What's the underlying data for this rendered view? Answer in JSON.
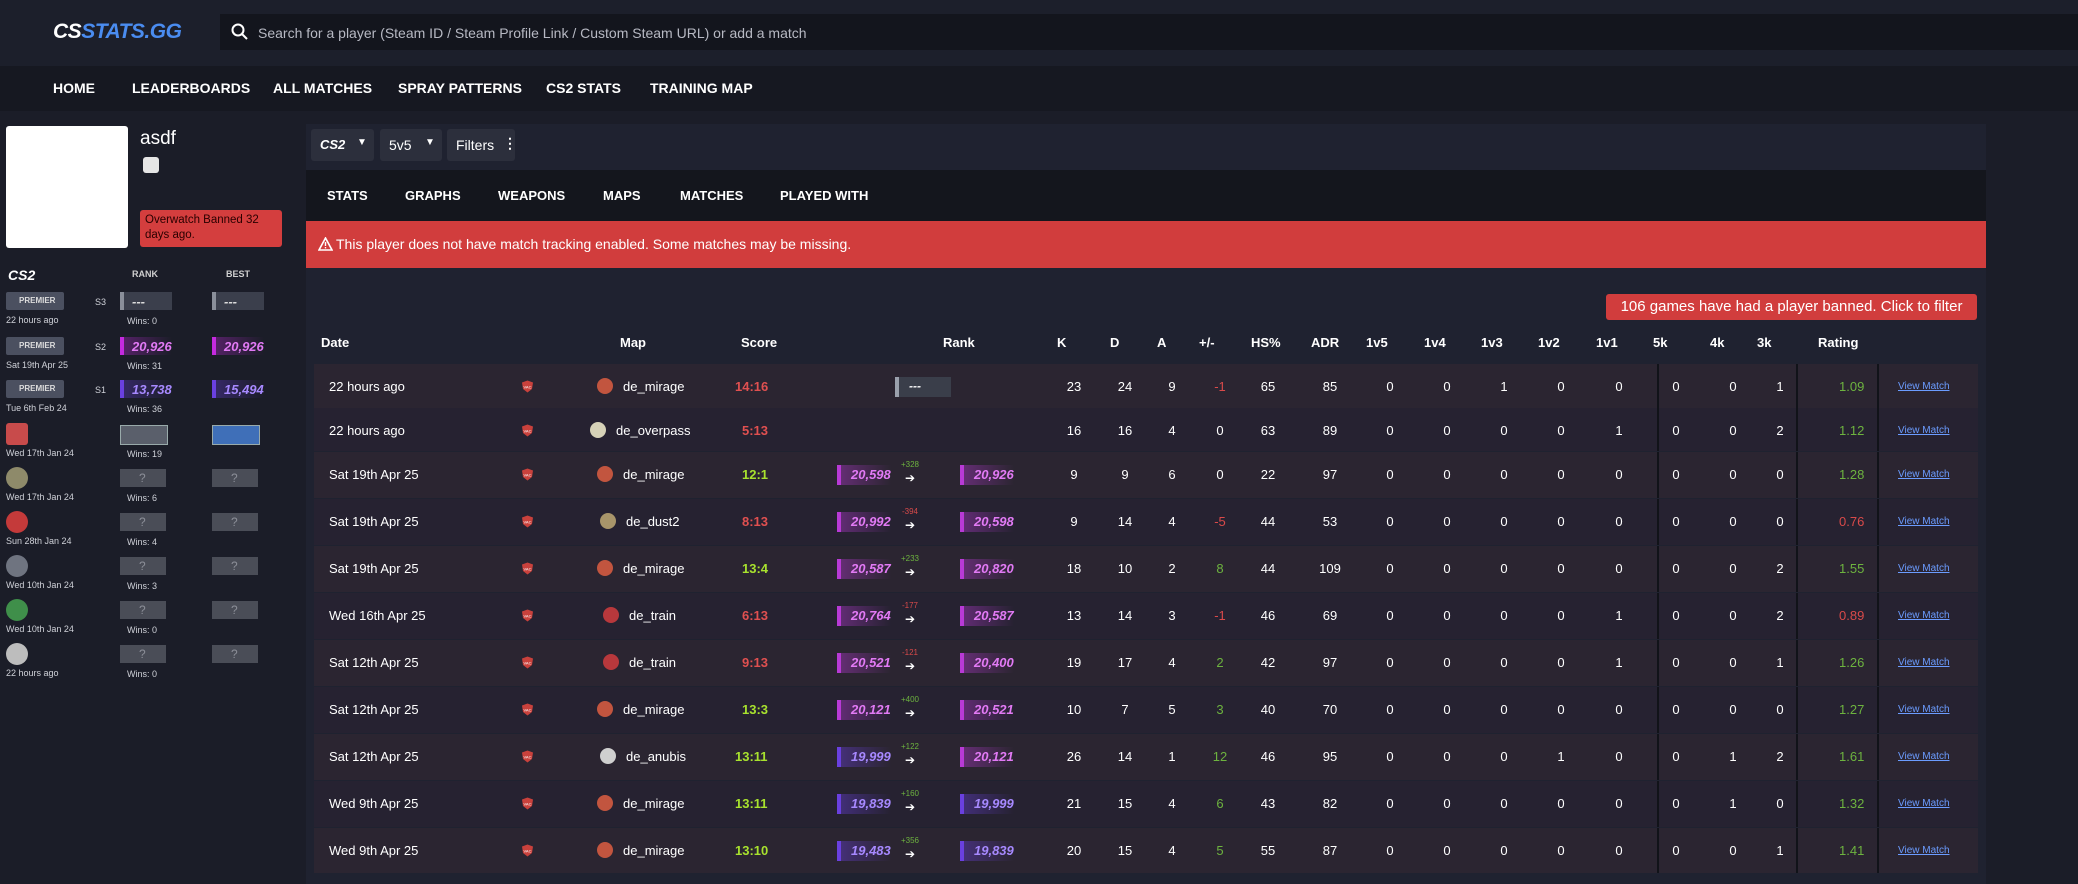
{
  "header": {
    "logo_a": "CS",
    "logo_b": "STATS.GG",
    "search_placeholder": "Search for a player (Steam ID / Steam Profile Link / Custom Steam URL) or add a match"
  },
  "nav": [
    "HOME",
    "LEADERBOARDS",
    "ALL MATCHES",
    "SPRAY PATTERNS",
    "CS2 STATS",
    "TRAINING MAP"
  ],
  "profile": {
    "name": "asdf",
    "ban_text": "Overwatch Banned 32 days ago."
  },
  "sidebar": {
    "logo": "CS2",
    "rank_header": "RANK",
    "best_header": "BEST",
    "rows": [
      {
        "date": "22 hours ago",
        "season": "S3",
        "rank": "---",
        "best": "---",
        "wins": "Wins: 0",
        "type": "premier",
        "color": "#8a8f9a"
      },
      {
        "date": "Sat 19th Apr 25",
        "season": "S2",
        "rank": "20,926",
        "best": "20,926",
        "wins": "Wins: 31",
        "type": "premier",
        "color": "#c42adf"
      },
      {
        "date": "Tue 6th Feb 24",
        "season": "S1",
        "rank": "13,738",
        "best": "15,494",
        "wins": "Wins: 36",
        "type": "premier",
        "color": "#6a40e0"
      },
      {
        "date": "Wed 17th Jan 24",
        "season": "",
        "rank": "",
        "best": "",
        "wins": "Wins: 19",
        "type": "competitive",
        "color": "#c84b4b"
      },
      {
        "date": "Wed 17th Jan 24",
        "season": "",
        "rank": "?",
        "best": "?",
        "wins": "Wins: 6",
        "type": "map",
        "color": "#8e8a6a"
      },
      {
        "date": "Sun 28th Jan 24",
        "season": "",
        "rank": "?",
        "best": "?",
        "wins": "Wins: 4",
        "type": "map",
        "color": "#c43a3a"
      },
      {
        "date": "Wed 10th Jan 24",
        "season": "",
        "rank": "?",
        "best": "?",
        "wins": "Wins: 3",
        "type": "map",
        "color": "#6f7480"
      },
      {
        "date": "Wed 10th Jan 24",
        "season": "",
        "rank": "?",
        "best": "?",
        "wins": "Wins: 0",
        "type": "map",
        "color": "#3f8f4a"
      },
      {
        "date": "22 hours ago",
        "season": "",
        "rank": "?",
        "best": "?",
        "wins": "Wins: 0",
        "type": "map",
        "color": "#bdbdbd"
      }
    ]
  },
  "controls": {
    "game": "CS2",
    "mode": "5v5",
    "filters": "Filters"
  },
  "tabs": [
    "STATS",
    "GRAPHS",
    "WEAPONS",
    "MAPS",
    "MATCHES",
    "PLAYED WITH"
  ],
  "alert": "This player does not have match tracking enabled. Some matches may be missing.",
  "banned_filter": "106 games have had a player banned. Click to filter",
  "columns": [
    "Date",
    "Map",
    "Score",
    "Rank",
    "K",
    "D",
    "A",
    "+/-",
    "HS%",
    "ADR",
    "1v5",
    "1v4",
    "1v3",
    "1v2",
    "1v1",
    "5k",
    "4k",
    "3k",
    "Rating"
  ],
  "view_label": "View Match",
  "colors": {
    "win": "#a8e22e",
    "loss": "#e05050",
    "tie": "#e05050",
    "pos": "#6db33f",
    "neg": "#d94a4a"
  },
  "matches": [
    {
      "date": "22 hours ago",
      "map": "de_mirage",
      "score": "14:16",
      "result": "loss",
      "rank_before": "",
      "delta": "",
      "rank_after": "",
      "unranked": true,
      "k": "23",
      "d": "24",
      "a": "9",
      "pm": "-1",
      "hs": "65",
      "adr": "85",
      "v5": "0",
      "v4": "0",
      "v3": "1",
      "v2": "0",
      "v1": "0",
      "k5": "0",
      "k4": "0",
      "k3": "1",
      "rating": "1.09",
      "rating_sign": "pos"
    },
    {
      "date": "22 hours ago",
      "map": "de_overpass",
      "score": "5:13",
      "result": "loss",
      "rank_before": "",
      "delta": "",
      "rank_after": "",
      "unranked": false,
      "k": "16",
      "d": "16",
      "a": "4",
      "pm": "0",
      "hs": "63",
      "adr": "89",
      "v5": "0",
      "v4": "0",
      "v3": "0",
      "v2": "0",
      "v1": "1",
      "k5": "0",
      "k4": "0",
      "k3": "2",
      "rating": "1.12",
      "rating_sign": "pos"
    },
    {
      "date": "Sat 19th Apr 25",
      "map": "de_mirage",
      "score": "12:1",
      "result": "win",
      "rank_before": "20,598",
      "delta": "+328",
      "rank_after": "20,926",
      "unranked": false,
      "k": "9",
      "d": "9",
      "a": "6",
      "pm": "0",
      "hs": "22",
      "adr": "97",
      "v5": "0",
      "v4": "0",
      "v3": "0",
      "v2": "0",
      "v1": "0",
      "k5": "0",
      "k4": "0",
      "k3": "0",
      "rating": "1.28",
      "rating_sign": "pos"
    },
    {
      "date": "Sat 19th Apr 25",
      "map": "de_dust2",
      "score": "8:13",
      "result": "loss",
      "rank_before": "20,992",
      "delta": "-394",
      "rank_after": "20,598",
      "unranked": false,
      "k": "9",
      "d": "14",
      "a": "4",
      "pm": "-5",
      "hs": "44",
      "adr": "53",
      "v5": "0",
      "v4": "0",
      "v3": "0",
      "v2": "0",
      "v1": "0",
      "k5": "0",
      "k4": "0",
      "k3": "0",
      "rating": "0.76",
      "rating_sign": "neg"
    },
    {
      "date": "Sat 19th Apr 25",
      "map": "de_mirage",
      "score": "13:4",
      "result": "win",
      "rank_before": "20,587",
      "delta": "+233",
      "rank_after": "20,820",
      "unranked": false,
      "k": "18",
      "d": "10",
      "a": "2",
      "pm": "8",
      "hs": "44",
      "adr": "109",
      "v5": "0",
      "v4": "0",
      "v3": "0",
      "v2": "0",
      "v1": "0",
      "k5": "0",
      "k4": "0",
      "k3": "2",
      "rating": "1.55",
      "rating_sign": "pos"
    },
    {
      "date": "Wed 16th Apr 25",
      "map": "de_train",
      "score": "6:13",
      "result": "loss",
      "rank_before": "20,764",
      "delta": "-177",
      "rank_after": "20,587",
      "unranked": false,
      "k": "13",
      "d": "14",
      "a": "3",
      "pm": "-1",
      "hs": "46",
      "adr": "69",
      "v5": "0",
      "v4": "0",
      "v3": "0",
      "v2": "0",
      "v1": "1",
      "k5": "0",
      "k4": "0",
      "k3": "2",
      "rating": "0.89",
      "rating_sign": "neg"
    },
    {
      "date": "Sat 12th Apr 25",
      "map": "de_train",
      "score": "9:13",
      "result": "loss",
      "rank_before": "20,521",
      "delta": "-121",
      "rank_after": "20,400",
      "unranked": false,
      "k": "19",
      "d": "17",
      "a": "4",
      "pm": "2",
      "hs": "42",
      "adr": "97",
      "v5": "0",
      "v4": "0",
      "v3": "0",
      "v2": "0",
      "v1": "1",
      "k5": "0",
      "k4": "0",
      "k3": "1",
      "rating": "1.26",
      "rating_sign": "pos"
    },
    {
      "date": "Sat 12th Apr 25",
      "map": "de_mirage",
      "score": "13:3",
      "result": "win",
      "rank_before": "20,121",
      "delta": "+400",
      "rank_after": "20,521",
      "unranked": false,
      "k": "10",
      "d": "7",
      "a": "5",
      "pm": "3",
      "hs": "40",
      "adr": "70",
      "v5": "0",
      "v4": "0",
      "v3": "0",
      "v2": "0",
      "v1": "0",
      "k5": "0",
      "k4": "0",
      "k3": "0",
      "rating": "1.27",
      "rating_sign": "pos"
    },
    {
      "date": "Sat 12th Apr 25",
      "map": "de_anubis",
      "score": "13:11",
      "result": "win",
      "rank_before": "19,999",
      "delta": "+122",
      "rank_after": "20,121",
      "unranked": false,
      "k": "26",
      "d": "14",
      "a": "1",
      "pm": "12",
      "hs": "46",
      "adr": "95",
      "v5": "0",
      "v4": "0",
      "v3": "0",
      "v2": "1",
      "v1": "0",
      "k5": "0",
      "k4": "1",
      "k3": "2",
      "rating": "1.61",
      "rating_sign": "pos"
    },
    {
      "date": "Wed 9th Apr 25",
      "map": "de_mirage",
      "score": "13:11",
      "result": "win",
      "rank_before": "19,839",
      "delta": "+160",
      "rank_after": "19,999",
      "unranked": false,
      "k": "21",
      "d": "15",
      "a": "4",
      "pm": "6",
      "hs": "43",
      "adr": "82",
      "v5": "0",
      "v4": "0",
      "v3": "0",
      "v2": "0",
      "v1": "0",
      "k5": "0",
      "k4": "1",
      "k3": "0",
      "rating": "1.32",
      "rating_sign": "pos"
    },
    {
      "date": "Wed 9th Apr 25",
      "map": "de_mirage",
      "score": "13:10",
      "result": "win",
      "rank_before": "19,483",
      "delta": "+356",
      "rank_after": "19,839",
      "unranked": false,
      "k": "20",
      "d": "15",
      "a": "4",
      "pm": "5",
      "hs": "55",
      "adr": "87",
      "v5": "0",
      "v4": "0",
      "v3": "0",
      "v2": "0",
      "v1": "0",
      "k5": "0",
      "k4": "0",
      "k3": "1",
      "rating": "1.41",
      "rating_sign": "pos"
    }
  ]
}
